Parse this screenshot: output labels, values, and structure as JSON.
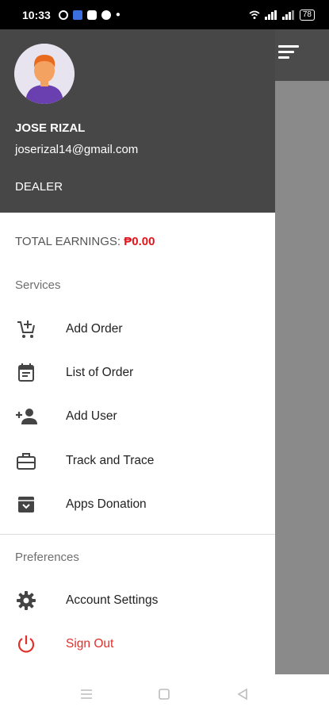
{
  "status_bar": {
    "time": "10:33",
    "battery": "78"
  },
  "user": {
    "name": "JOSE RIZAL",
    "email": "joserizal14@gmail.com",
    "role": "DEALER"
  },
  "earnings": {
    "label": "TOTAL EARNINGS: ",
    "amount": "₱0.00"
  },
  "services": {
    "title": "Services",
    "items": [
      {
        "label": "Add Order",
        "icon": "add-cart-icon"
      },
      {
        "label": "List of Order",
        "icon": "calendar-list-icon"
      },
      {
        "label": "Add User",
        "icon": "add-user-icon"
      },
      {
        "label": "Track and Trace",
        "icon": "briefcase-icon"
      },
      {
        "label": "Apps Donation",
        "icon": "archive-icon"
      }
    ]
  },
  "preferences": {
    "title": "Preferences",
    "items": [
      {
        "label": "Account Settings",
        "icon": "gear-icon"
      },
      {
        "label": "Sign Out",
        "icon": "power-icon"
      }
    ]
  },
  "colors": {
    "header_bg": "#474747",
    "accent_red": "#e0161c",
    "backdrop": "#8a8a8a"
  }
}
